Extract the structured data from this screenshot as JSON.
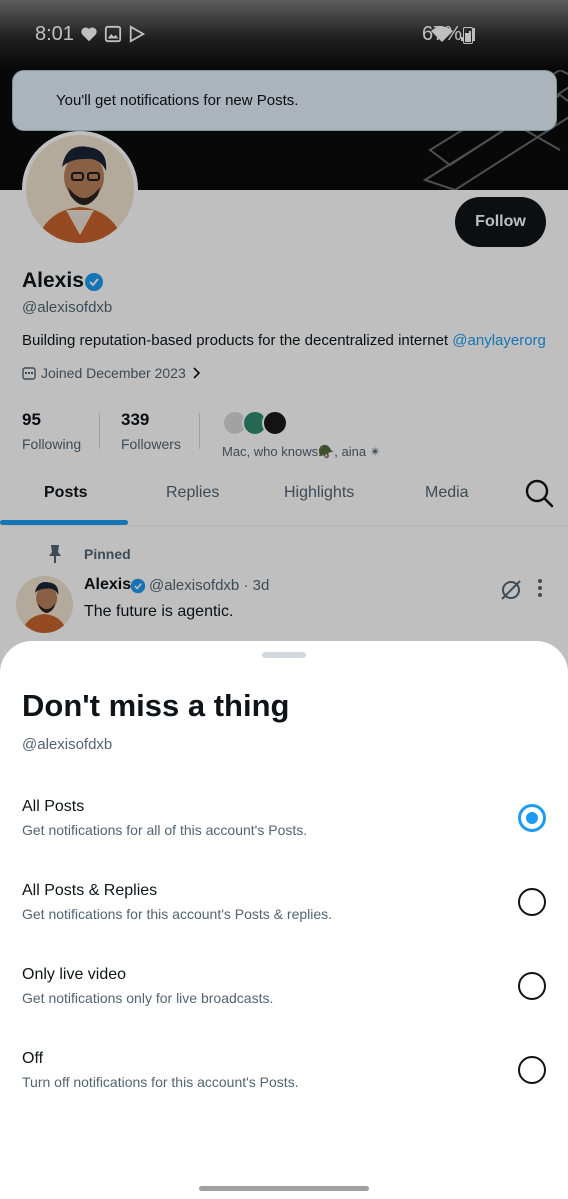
{
  "status_bar": {
    "time": "8:01",
    "battery": "67%"
  },
  "toast": {
    "text": "You'll get notifications for new Posts."
  },
  "profile": {
    "follow_label": "Follow",
    "name": "Alexis",
    "handle": "@alexisofdxb",
    "bio": "Building reputation-based products for the decentralized internet ",
    "bio_link": "@anylayerorg",
    "joined": "Joined December 2023",
    "following_count": "95",
    "following_label": "Following",
    "followers_count": "339",
    "followers_label": "Followers",
    "followed_by": "Mac, who knows🪖, aina ✴"
  },
  "tabs": [
    {
      "label": "Posts",
      "active": true
    },
    {
      "label": "Replies"
    },
    {
      "label": "Highlights"
    },
    {
      "label": "Media"
    }
  ],
  "pinned_post": {
    "pinned_label": "Pinned",
    "name": "Alexis",
    "handle_time": "@alexisofdxb · 3d",
    "text": "The future is agentic."
  },
  "sheet": {
    "title": "Don't miss a thing",
    "handle": "@alexisofdxb",
    "options": [
      {
        "title": "All Posts",
        "description": "Get notifications for all of this account's Posts.",
        "selected": true
      },
      {
        "title": "All Posts & Replies",
        "description": "Get notifications for this account's Posts & replies.",
        "selected": false
      },
      {
        "title": "Only live video",
        "description": "Get notifications only for live broadcasts.",
        "selected": false
      },
      {
        "title": "Off",
        "description": "Turn off notifications for this account's Posts.",
        "selected": false
      }
    ]
  },
  "colors": {
    "accent": "#1d9bf0",
    "text": "#0f1419",
    "secondary": "#536471",
    "toast_bg": "#e3f1f9"
  },
  "icons": [
    "heart-icon",
    "gallery-icon",
    "play-store-icon",
    "wifi-icon",
    "signal-icon",
    "battery-icon",
    "verified-badge-icon",
    "calendar-icon",
    "chevron-right-icon",
    "search-icon",
    "pin-icon",
    "grok-icon",
    "more-vertical-icon"
  ]
}
